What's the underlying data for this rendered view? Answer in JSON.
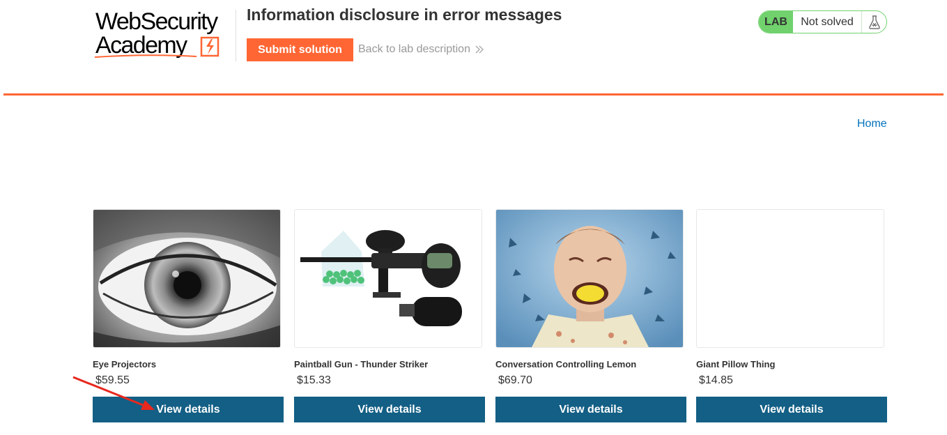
{
  "brand": {
    "line1": "WebSecurity",
    "line2": "Academy",
    "accent_color": "#ff6633"
  },
  "lab": {
    "title": "Information disclosure in error messages",
    "submit_label": "Submit solution",
    "back_label": "Back to lab description",
    "status_tag": "LAB",
    "status_text": "Not solved",
    "status_color": "#70d16d"
  },
  "nav": {
    "home_label": "Home",
    "link_color": "#0071bc"
  },
  "products": [
    {
      "name": "Eye Projectors",
      "price": "$59.55",
      "button_label": "View details",
      "image": "eye-closeup-photo"
    },
    {
      "name": "Paintball Gun - Thunder Striker",
      "price": "$15.33",
      "button_label": "View details",
      "image": "paintball-gun-photo"
    },
    {
      "name": "Conversation Controlling Lemon",
      "price": "$69.70",
      "button_label": "View details",
      "image": "man-with-lemon-photo"
    },
    {
      "name": "Giant Pillow Thing",
      "price": "$14.85",
      "button_label": "View details",
      "image": "blank-image"
    }
  ],
  "colors": {
    "button_primary": "#135f85",
    "annotation_arrow": "#e8281e"
  }
}
